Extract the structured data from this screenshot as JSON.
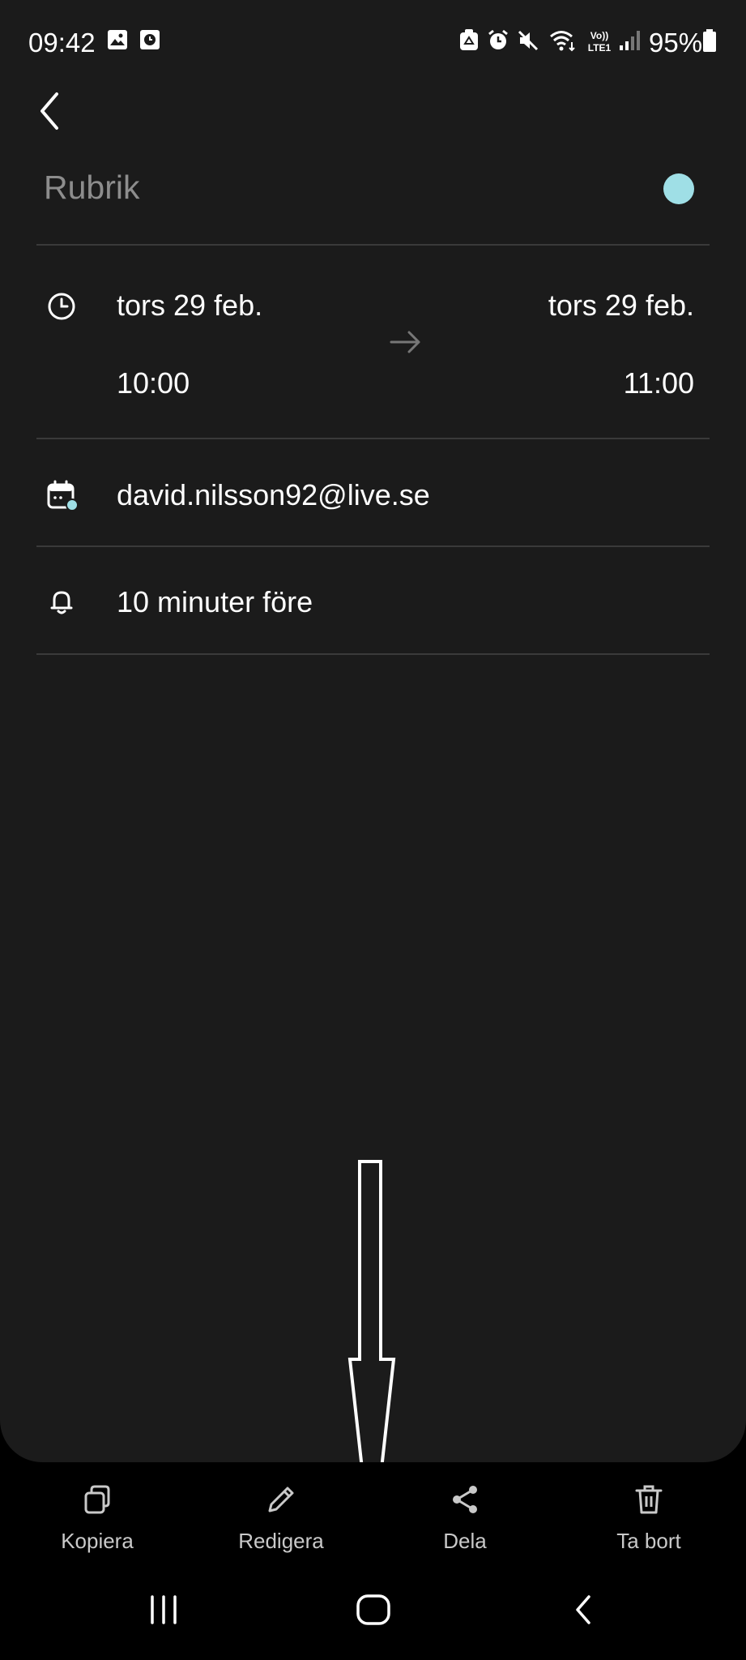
{
  "status_bar": {
    "time": "09:42",
    "battery": "95%",
    "left_icons": [
      "gallery-icon",
      "clock-app-icon"
    ],
    "right_icons": [
      "eco-icon",
      "alarm-icon",
      "mute-icon",
      "wifi-icon",
      "volte-icon",
      "signal-icon",
      "battery-icon"
    ],
    "volte_label": "Vo)) LTE1"
  },
  "event": {
    "title": "Rubrik",
    "color": "#9fdfe6",
    "start_date": "tors 29 feb.",
    "start_time": "10:00",
    "end_date": "tors 29 feb.",
    "end_time": "11:00",
    "calendar_account": "david.nilsson92@live.se",
    "reminder": "10 minuter före"
  },
  "toolbar": {
    "copy_label": "Kopiera",
    "edit_label": "Redigera",
    "share_label": "Dela",
    "delete_label": "Ta bort"
  },
  "nav_bar": {
    "buttons": [
      "recents-icon",
      "home-icon",
      "back-icon"
    ]
  }
}
